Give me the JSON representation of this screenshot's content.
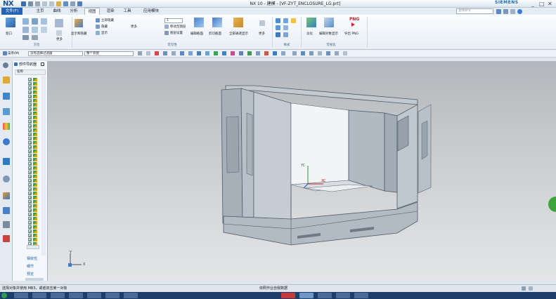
{
  "app": {
    "logo": "NX",
    "window_title": "NX 10 - 建模 - [VF-ZYT_ENCLOSURE_LG.prt]",
    "brand": "SIEMENS",
    "minimize_label": "_",
    "restore_label": "□",
    "close_label": "✕"
  },
  "tabs": [
    "文件(F)",
    "主页",
    "曲线",
    "分析",
    "视图",
    "渲染",
    "工具",
    "应用模块"
  ],
  "active_tab": "视图",
  "command_search": {
    "placeholder": "查找命令"
  },
  "ribbon": {
    "groups": [
      "方位",
      "可见性",
      "样式",
      "可视化"
    ],
    "buttons": {
      "camera": "显示和隐藏",
      "show_hide_items": [
        "立即隐藏",
        "隐藏",
        "显示"
      ],
      "more1": "更多",
      "layer_value": "1",
      "layer_settings": "移动至图层",
      "layer_visible": "图层设置",
      "edit_section": "编辑截面",
      "clip_section": "剪切截面",
      "show_all": "全部通透显示",
      "more2": "更多",
      "fade": "淡化",
      "edit_object_display": "编辑对象显示",
      "export_png": "导出 PNG",
      "png": "PNG"
    }
  },
  "selection_bar": {
    "menu": "菜单(M)",
    "filter": "没有选择过滤器",
    "scope": "整个装配"
  },
  "navigator": {
    "title": "部件导航器",
    "column_header": "名称",
    "links": [
      "相依性",
      "细节",
      "预览"
    ]
  },
  "viewport": {
    "triad_labels": [
      "YC",
      "XC"
    ],
    "wcs_y": "Y",
    "wcs_x": "X"
  },
  "status_bar": {
    "left": "选择对象并使用 MB3，或者双击某一对象",
    "middle": "依照作业自我数据"
  },
  "colors": {
    "title_blue": "#1b4f96",
    "file_tab": "#2463b5",
    "model_gray": "#98a3ae",
    "background_top": "#b3b7bb",
    "background_bottom": "#e4e5e6"
  }
}
